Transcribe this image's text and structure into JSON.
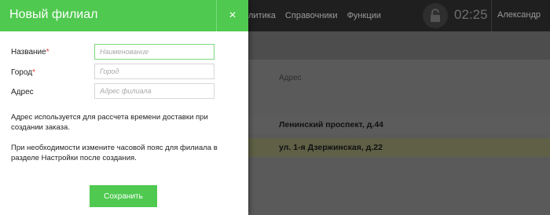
{
  "app": {
    "nav": {
      "analytics": "литика",
      "directories": "Справочники",
      "functions": "Функции"
    },
    "clock": "02:25",
    "user": "Александр",
    "table": {
      "address_header": "Адрес",
      "rows": [
        {
          "address": "Ленинский проспект, д.44"
        },
        {
          "address": "ул. 1-я Дзержинская, д.22"
        }
      ]
    }
  },
  "modal": {
    "title": "Новый филиал",
    "close_label": "×",
    "fields": {
      "name": {
        "label": "Название",
        "required_mark": "*",
        "placeholder": "Наименование",
        "value": ""
      },
      "city": {
        "label": "Город",
        "required_mark": "*",
        "placeholder": "Город",
        "value": ""
      },
      "address": {
        "label": "Адрес",
        "placeholder": "Адрес филиала",
        "value": ""
      }
    },
    "info_address": "Адрес используется для рассчета времени доставки при создании заказа.",
    "info_timezone": "При необходимости измените часовой пояс для филиала в разделе Настройки после создания.",
    "save_label": "Сохранить"
  }
}
